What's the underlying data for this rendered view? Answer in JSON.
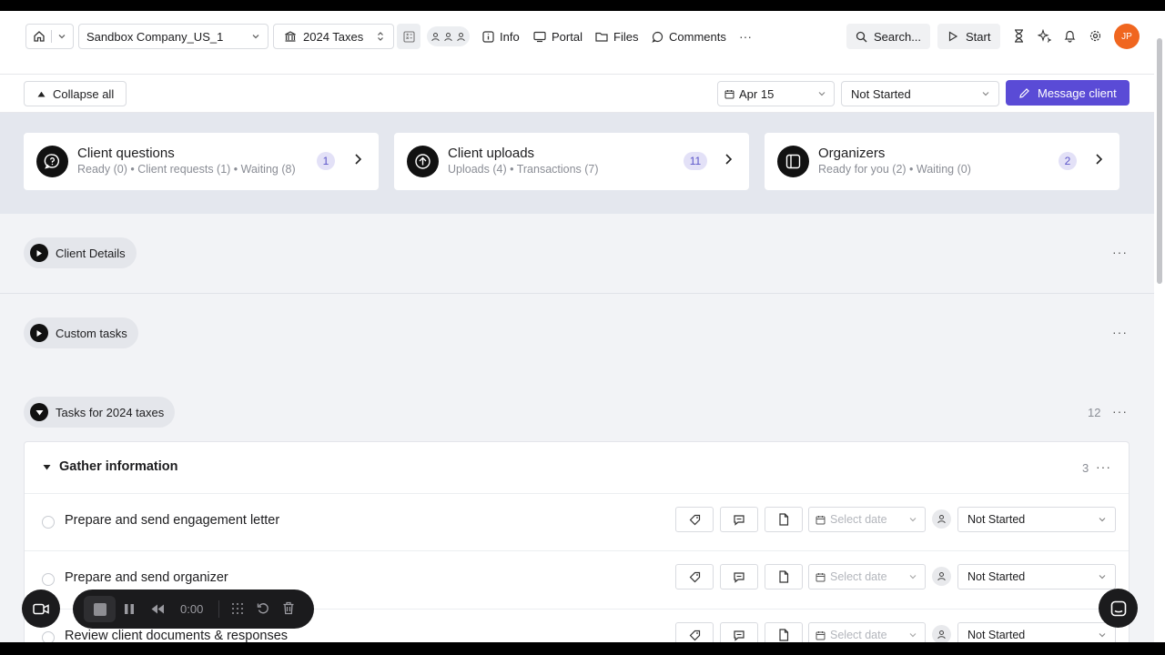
{
  "topbar": {
    "company_select": "Sandbox Company_US_1",
    "project_select": "2024 Taxes",
    "nav": [
      "Info",
      "Portal",
      "Files",
      "Comments"
    ],
    "more": "···",
    "search": "Search...",
    "start": "Start",
    "user_initials": "JP"
  },
  "subbar": {
    "collapse_all": "Collapse all",
    "date": "Apr 15",
    "status": "Not Started",
    "message_client": "Message client"
  },
  "cards": [
    {
      "title": "Client questions",
      "subtitle": "Ready (0) • Client requests (1) • Waiting (8)",
      "badge": "1",
      "icon": "question-bubble-icon"
    },
    {
      "title": "Client uploads",
      "subtitle": "Uploads (4) • Transactions (7)",
      "badge": "11",
      "icon": "upload-arrow-icon"
    },
    {
      "title": "Organizers",
      "subtitle": "Ready for you (2) • Waiting (0)",
      "badge": "2",
      "icon": "organizer-panel-icon"
    }
  ],
  "sections": {
    "client_details": "Client Details",
    "custom_tasks": "Custom tasks",
    "tasks_2024": "Tasks for 2024 taxes",
    "tasks_2024_count": "12"
  },
  "group": {
    "title": "Gather information",
    "count": "3"
  },
  "tasks": [
    {
      "title": "Prepare and send engagement letter",
      "date_placeholder": "Select date",
      "status": "Not Started"
    },
    {
      "title": "Prepare and send organizer",
      "date_placeholder": "Select date",
      "status": "Not Started"
    },
    {
      "title": "Review client documents & responses",
      "date_placeholder": "Select date",
      "status": "Not Started"
    }
  ],
  "recorder": {
    "time": "0:00"
  },
  "colors": {
    "accent": "#5a4bd6",
    "avatar": "#f0661f",
    "badge_bg": "#e3e1f7"
  }
}
